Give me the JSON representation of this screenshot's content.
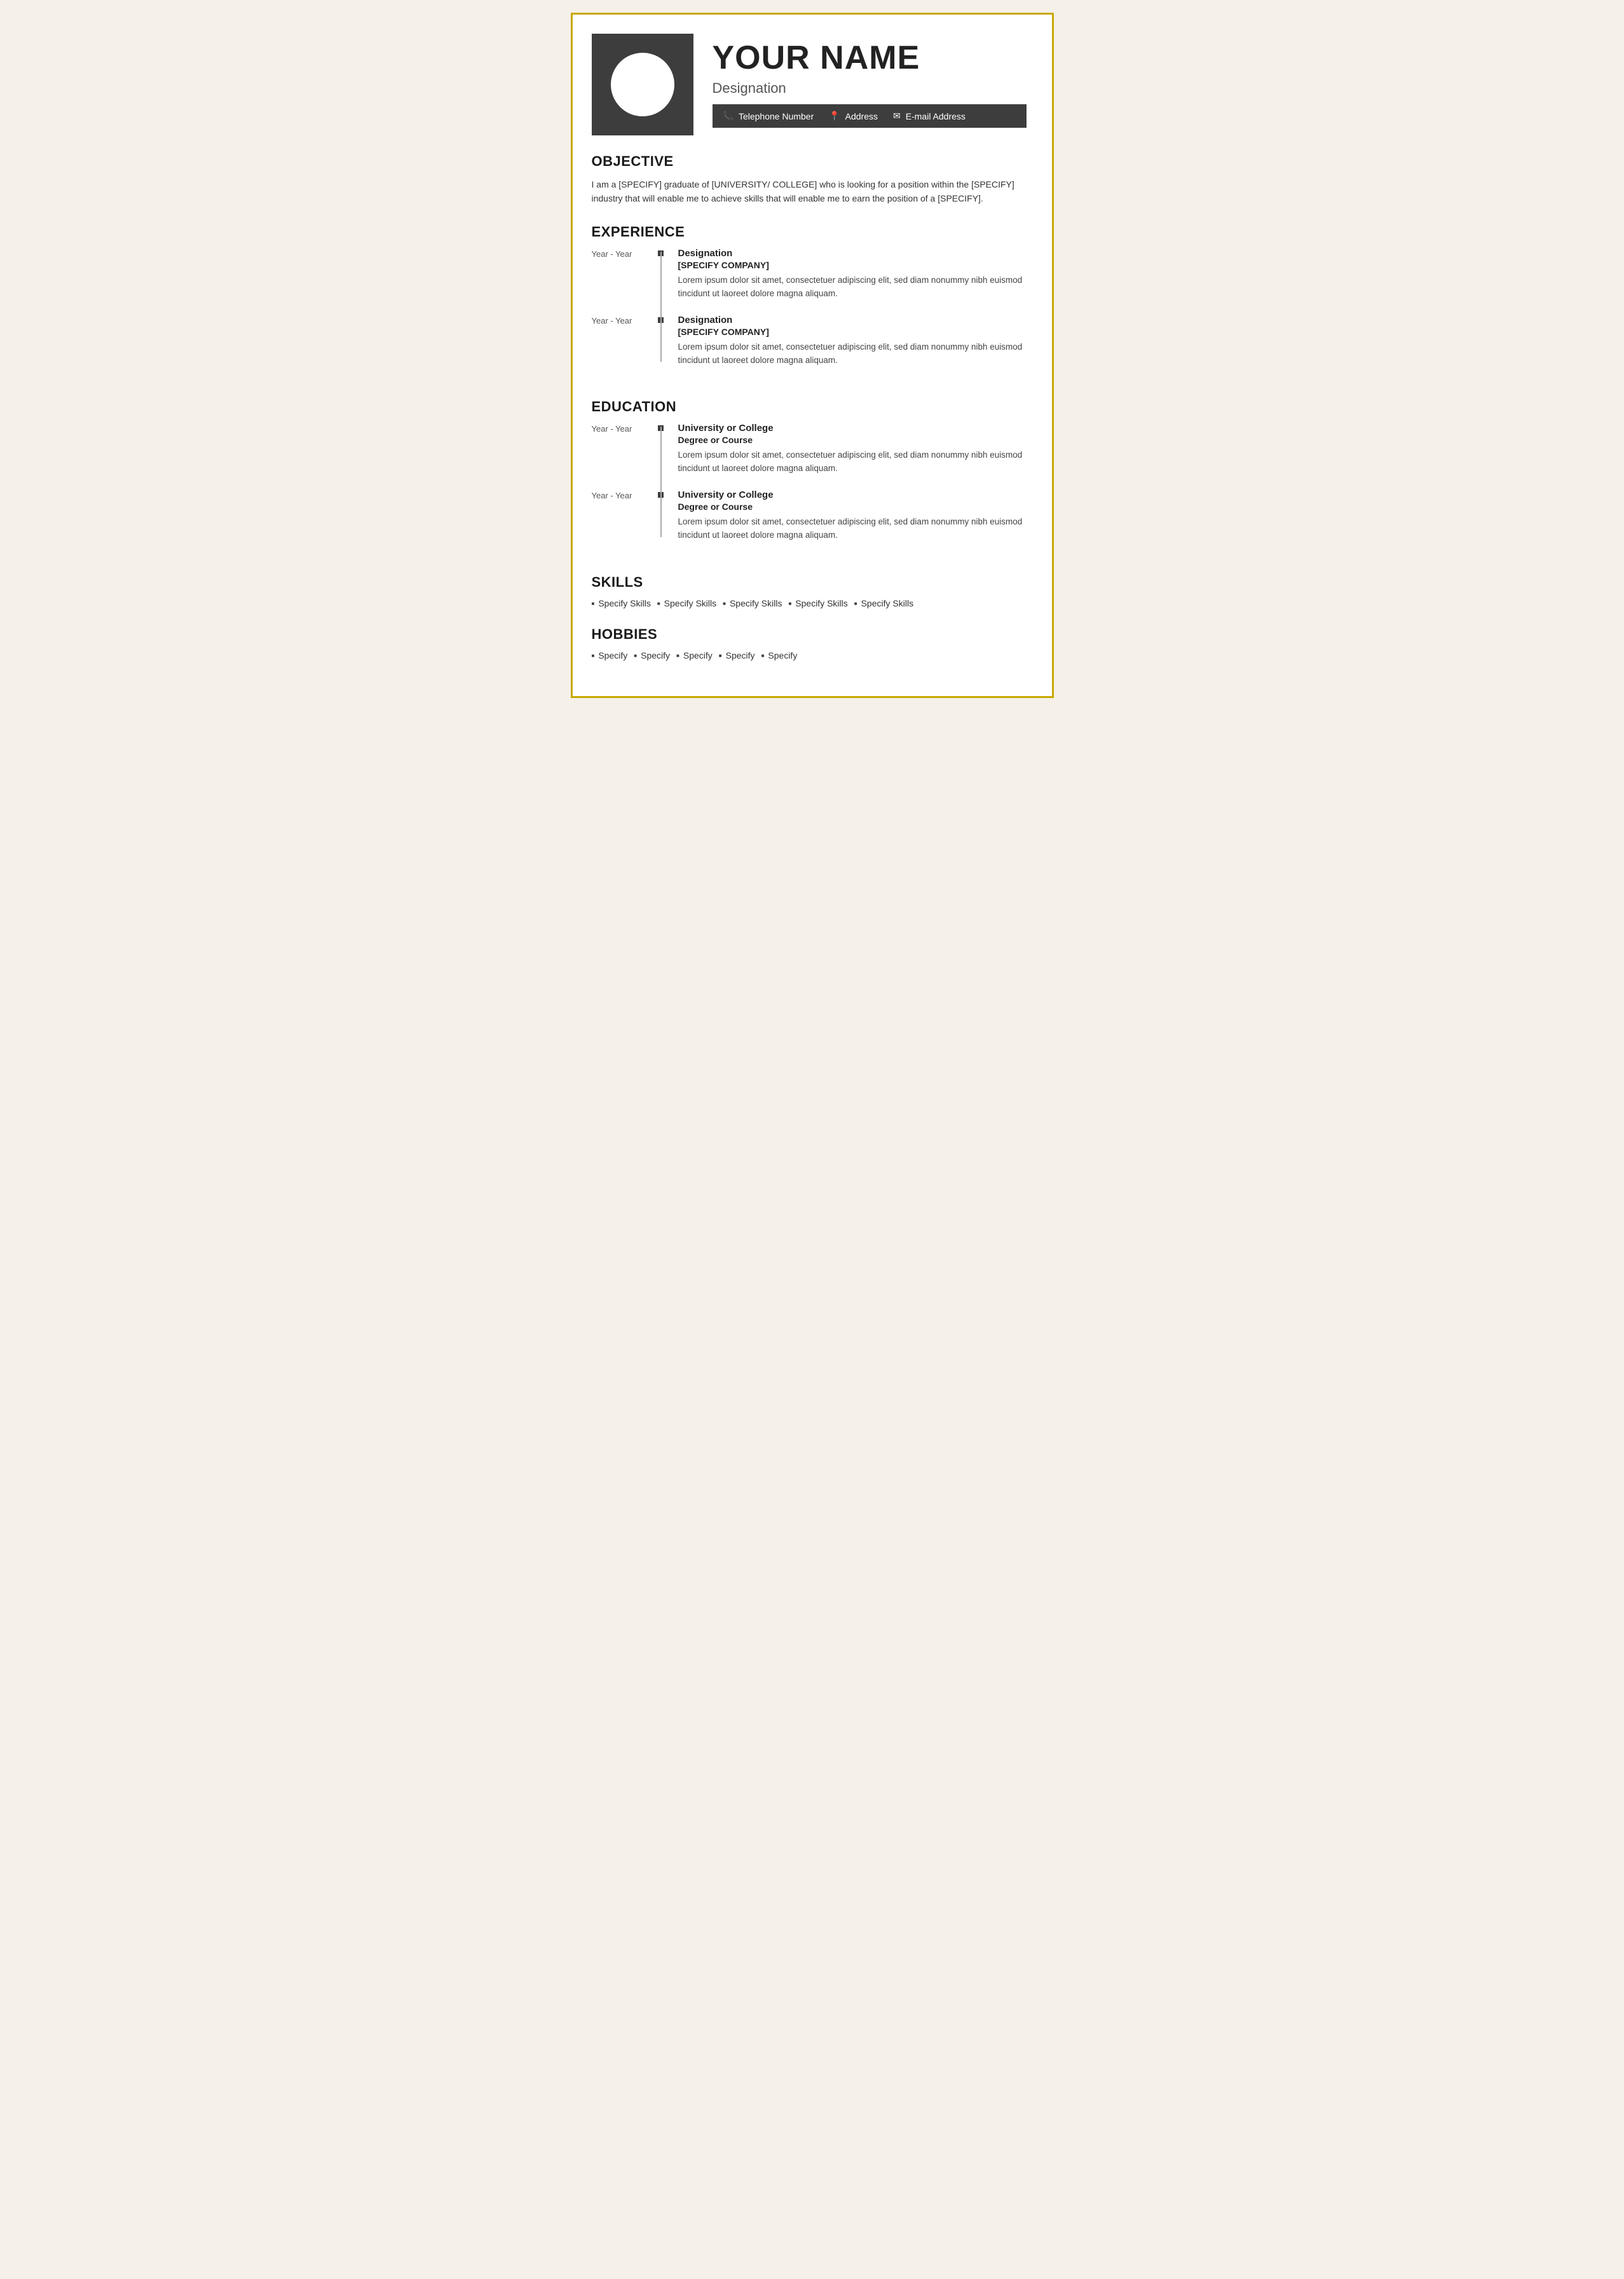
{
  "header": {
    "name": "YOUR NAME",
    "designation": "Designation",
    "contact": {
      "phone_label": "Telephone Number",
      "address_label": "Address",
      "email_label": "E-mail Address"
    }
  },
  "sections": {
    "objective": {
      "title": "OBJECTIVE",
      "text": "I am a [SPECIFY] graduate of [UNIVERSITY/ COLLEGE] who is looking for a position within the [SPECIFY] industry that will enable me to achieve skills that will enable me to earn the position of a [SPECIFY]."
    },
    "experience": {
      "title": "EXPERIENCE",
      "items": [
        {
          "years": "Year - Year",
          "designation": "Designation",
          "company": "[SPECIFY COMPANY]",
          "desc": "Lorem ipsum dolor sit amet, consectetuer adipiscing elit, sed diam nonummy nibh euismod tincidunt ut laoreet dolore magna aliquam."
        },
        {
          "years": "Year - Year",
          "designation": "Designation",
          "company": "[SPECIFY COMPANY]",
          "desc": "Lorem ipsum dolor sit amet, consectetuer adipiscing elit, sed diam nonummy nibh euismod tincidunt ut laoreet dolore magna aliquam."
        }
      ]
    },
    "education": {
      "title": "EDUCATION",
      "items": [
        {
          "years": "Year - Year",
          "university": "University or College",
          "degree": "Degree or Course",
          "desc": "Lorem ipsum dolor sit amet, consectetuer adipiscing elit, sed diam nonummy nibh euismod tincidunt ut laoreet dolore magna aliquam."
        },
        {
          "years": "Year - Year",
          "university": "University or College",
          "degree": "Degree or Course",
          "desc": "Lorem ipsum dolor sit amet, consectetuer adipiscing elit, sed diam nonummy nibh euismod tincidunt ut laoreet dolore magna aliquam."
        }
      ]
    },
    "skills": {
      "title": "SKILLS",
      "items": [
        "Specify Skills",
        "Specify Skills",
        "Specify Skills",
        "Specify Skills",
        "Specify Skills"
      ]
    },
    "hobbies": {
      "title": "HOBBIES",
      "items": [
        "Specify",
        "Specify",
        "Specify",
        "Specify",
        "Specify"
      ]
    }
  },
  "colors": {
    "dark": "#3d3d3d",
    "accent": "#c8a800",
    "text": "#333333",
    "light_text": "#555555"
  }
}
